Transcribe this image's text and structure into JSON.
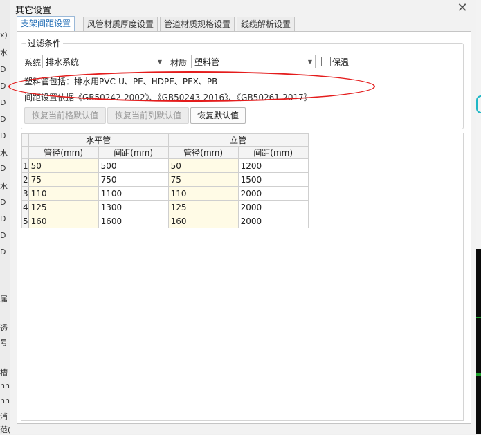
{
  "left_fragments": [
    "x)",
    "水",
    "D",
    "D",
    "D",
    "D",
    "D",
    "水",
    "D",
    "水",
    "D",
    "D",
    "D",
    "D",
    "属",
    "透",
    "号",
    "槽",
    "nn",
    "nn",
    "消",
    "范(m)"
  ],
  "dialog": {
    "title": "其它设置",
    "close_icon": "close-icon"
  },
  "tabs": [
    {
      "label": "支架间距设置",
      "active": true
    },
    {
      "label": "风管材质厚度设置",
      "active": false
    },
    {
      "label": "管道材质规格设置",
      "active": false
    },
    {
      "label": "线缆解析设置",
      "active": false
    }
  ],
  "filter": {
    "group_title": "过滤条件",
    "system_label": "系统",
    "system_value": "排水系统",
    "material_label": "材质",
    "material_value": "塑料管",
    "insulation_label": "保温",
    "insulation_checked": false
  },
  "info": {
    "plastic_note": "塑料管包括：排水用PVC-U、PE、HDPE、PEX、PB",
    "basis_note": "间距设置依据《GB50242-2002》、《GB50243-2016》、《GB50261-2017》"
  },
  "buttons": {
    "restore_cell": "恢复当前格默认值",
    "restore_column": "恢复当前列默认值",
    "restore_default": "恢复默认值"
  },
  "table": {
    "group_headers": [
      "水平管",
      "立管"
    ],
    "columns": [
      "管径(mm)",
      "间距(mm)",
      "管径(mm)",
      "间距(mm)"
    ],
    "rows": [
      {
        "n": "1",
        "cells": [
          "50",
          "500",
          "50",
          "1200"
        ]
      },
      {
        "n": "2",
        "cells": [
          "75",
          "750",
          "75",
          "1500"
        ]
      },
      {
        "n": "3",
        "cells": [
          "110",
          "1100",
          "110",
          "2000"
        ]
      },
      {
        "n": "4",
        "cells": [
          "125",
          "1300",
          "125",
          "2000"
        ]
      },
      {
        "n": "5",
        "cells": [
          "160",
          "1600",
          "160",
          "2000"
        ]
      }
    ]
  },
  "colors": {
    "active_tab_text": "#2a73b8",
    "annotation_ellipse": "#e41c1c",
    "editable_cell_bg": "#fffbe6"
  }
}
